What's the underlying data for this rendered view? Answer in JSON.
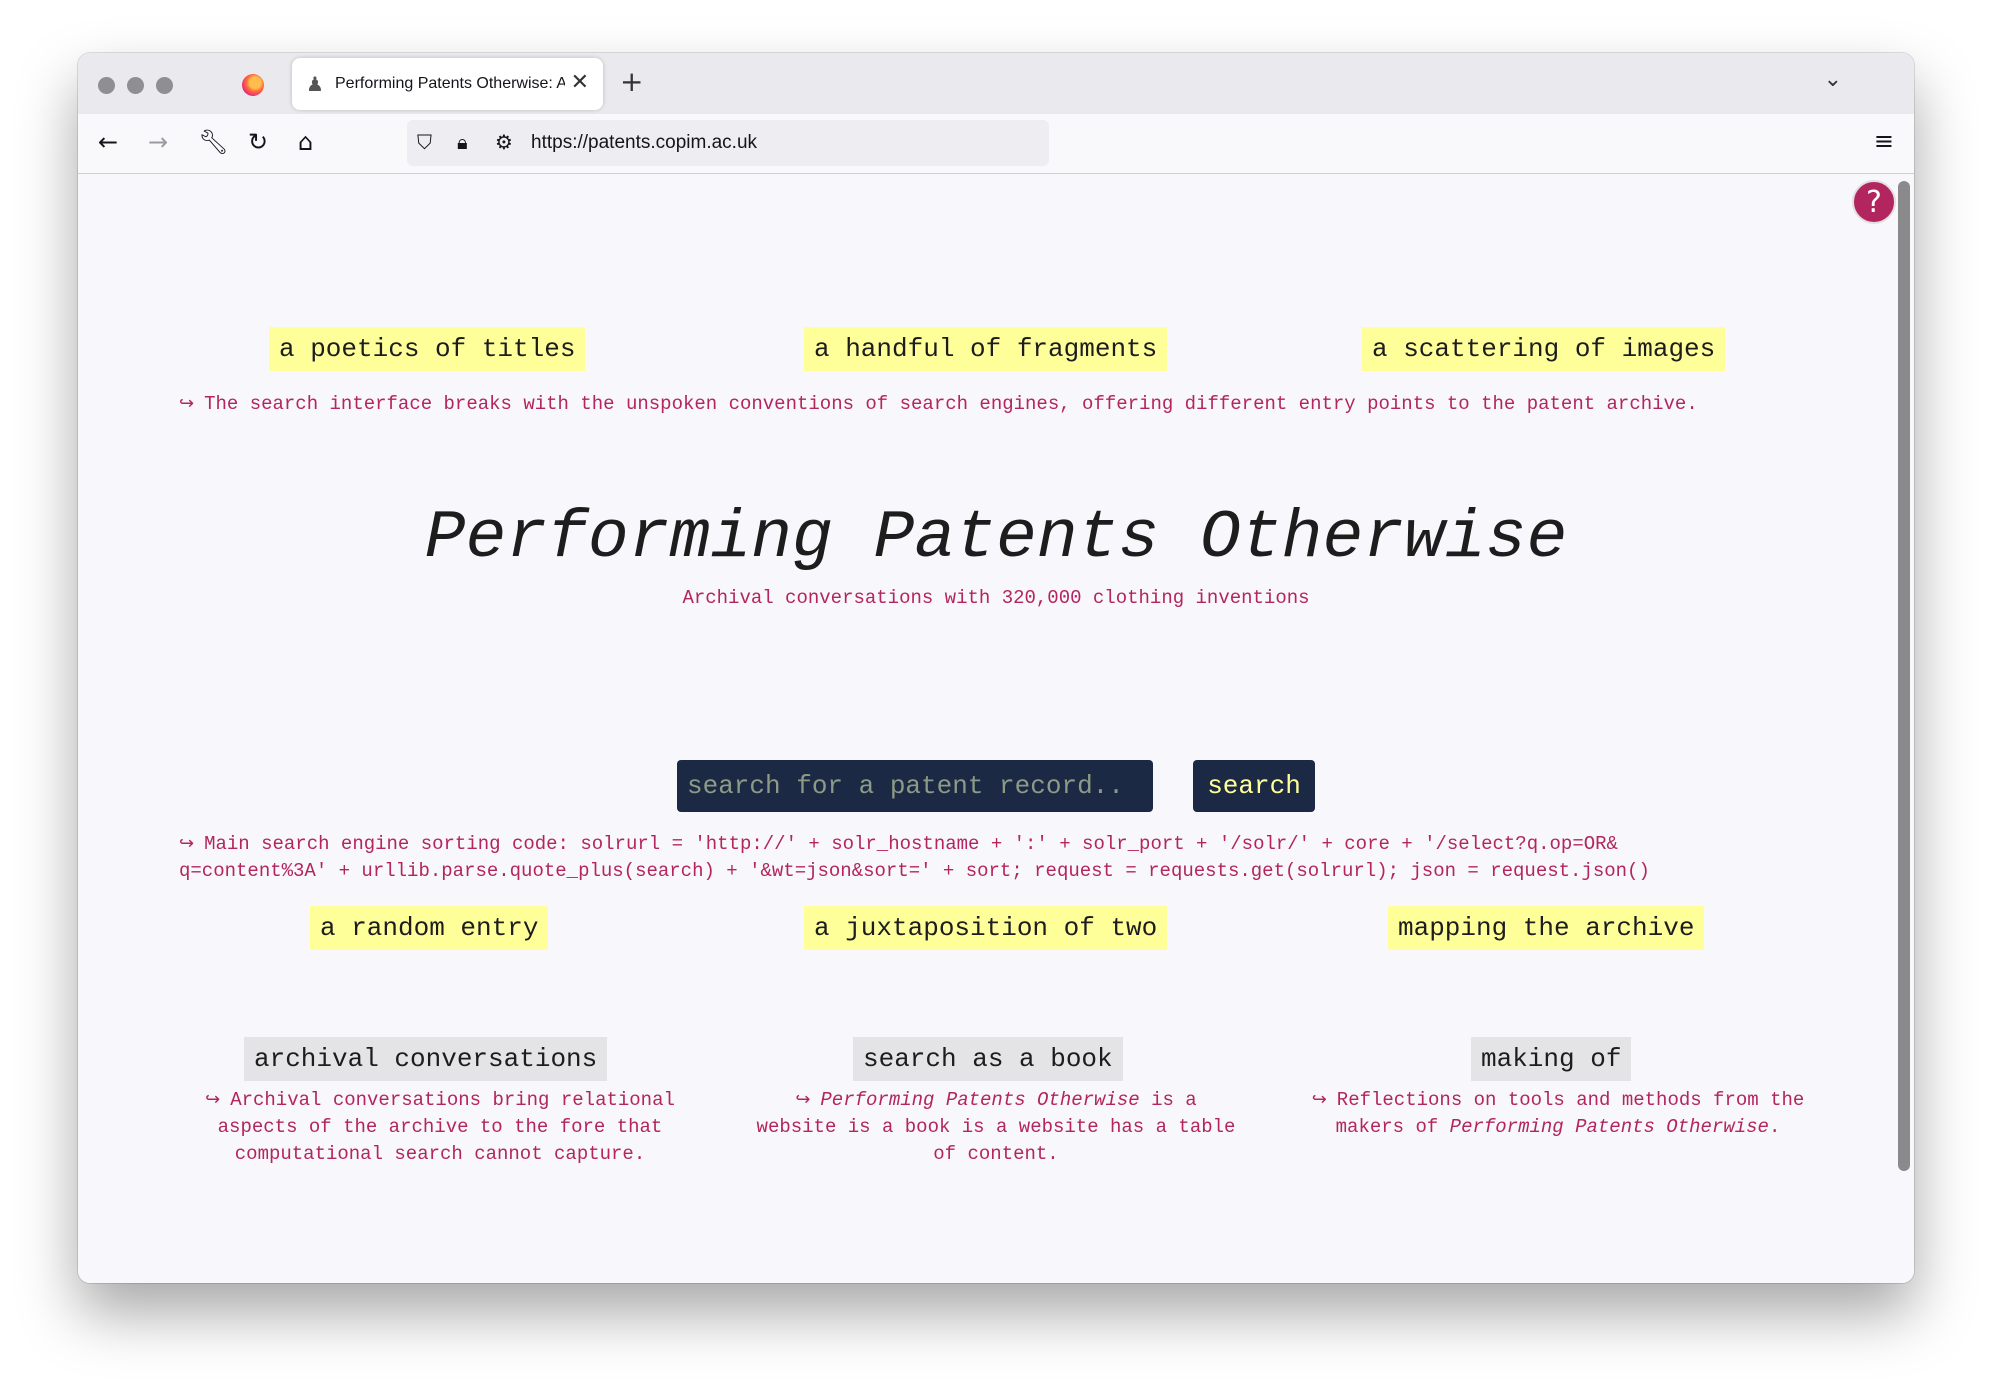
{
  "browser": {
    "tab_title": "Performing Patents Otherwise: A",
    "url": "https://patents.copim.ac.uk"
  },
  "top_links": [
    {
      "label": "a poetics of titles"
    },
    {
      "label": "a handful of fragments"
    },
    {
      "label": "a scattering of images"
    }
  ],
  "top_note": "The search interface breaks with the unspoken conventions of search engines, offering different entry points to the patent archive.",
  "title": "Performing Patents Otherwise",
  "subtitle": "Archival conversations with 320,000 clothing inventions",
  "search": {
    "placeholder": "search for a patent record..",
    "button_label": "search"
  },
  "code_note": {
    "line1": "Main search engine sorting code: solrurl = 'http://' + solr_hostname + ':' + solr_port + '/solr/' + core + '/select?q.op=OR&",
    "line2": "q=content%3A' + urllib.parse.quote_plus(search) + '&wt=json&sort=' + sort; request = requests.get(solrurl); json = request.json()"
  },
  "bottom_links": [
    {
      "label": "a random entry"
    },
    {
      "label": "a juxtaposition of two"
    },
    {
      "label": "mapping the archive"
    }
  ],
  "sections": [
    {
      "label": "archival conversations",
      "note": "Archival conversations bring relational aspects of the archive to the fore that computational search cannot capture."
    },
    {
      "label": "search as a book",
      "note_em": "Performing Patents Otherwise",
      "note_rest": " is a website is a book is a website has a table of content."
    },
    {
      "label": "making of",
      "note_pre": "Reflections on tools and methods from the makers of ",
      "note_em": "Performing Patents Otherwise",
      "note_post": "."
    }
  ],
  "colors": {
    "accent": "#b3255f",
    "highlight": "#ffff9a",
    "search_bg": "#1c2945",
    "page_bg": "#f8f7fc"
  }
}
